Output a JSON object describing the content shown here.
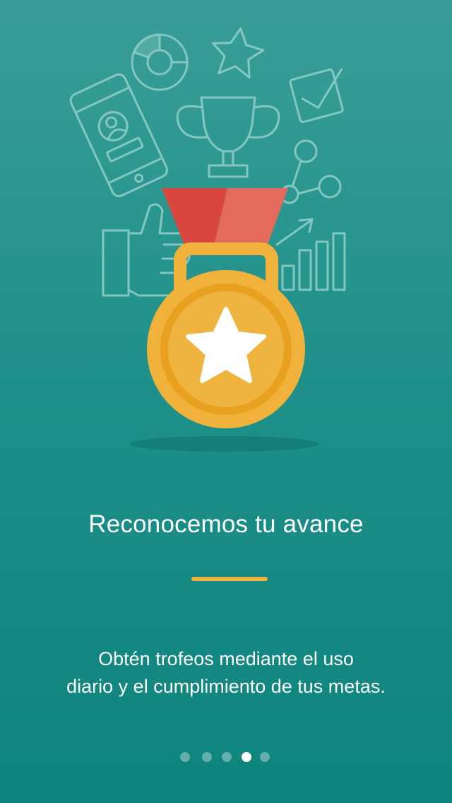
{
  "onboarding": {
    "title": "Reconocemos tu avance",
    "description_lines": [
      "Obtén trofeos mediante el uso",
      "diario y el cumplimiento de tus metas."
    ],
    "pager": {
      "total": 5,
      "current_index": 3
    }
  },
  "colors": {
    "background_top": "#3a9d97",
    "background_bottom": "#0d847d",
    "accent": "#f0b23a",
    "ribbon": "#e0514a",
    "medal": "#f0b23a"
  },
  "illustration": {
    "icons": [
      "donut-chart-icon",
      "star-outline-icon",
      "checkbox-icon",
      "smartphone-icon",
      "trophy-icon",
      "network-nodes-icon",
      "thumbs-up-icon",
      "bar-chart-icon",
      "medal-icon"
    ]
  }
}
